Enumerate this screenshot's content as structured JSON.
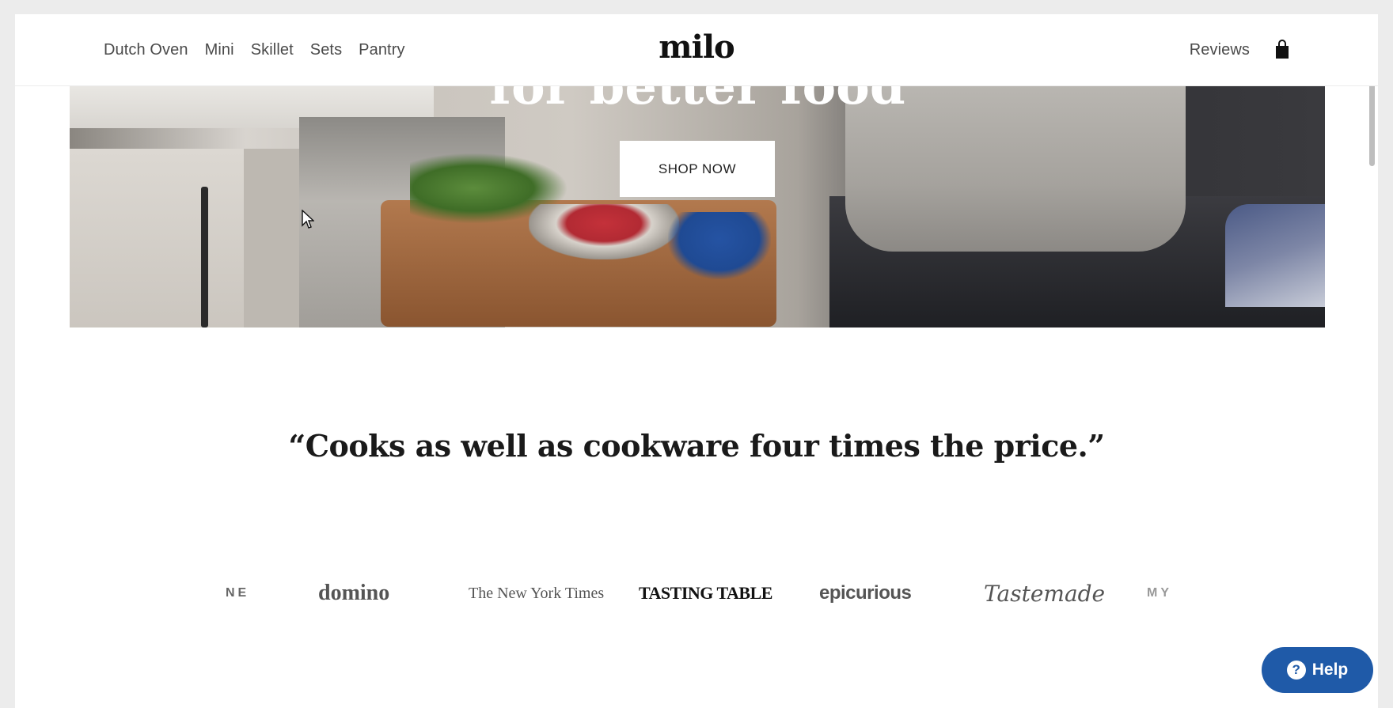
{
  "header": {
    "nav_left": [
      "Dutch Oven",
      "Mini",
      "Skillet",
      "Sets",
      "Pantry"
    ],
    "logo": "milo",
    "nav_right": {
      "reviews": "Reviews",
      "cart_icon": "shopping-bag-icon"
    }
  },
  "hero": {
    "headline": "for better food",
    "cta_label": "SHOP NOW"
  },
  "quote": {
    "text": "“Cooks as well as cookware four times the price.”"
  },
  "press_logos": [
    "NE",
    "domino",
    "The New York Times",
    "TASTING TABLE",
    "epicurious",
    "Tastemade",
    "MY"
  ],
  "help": {
    "label": "Help",
    "icon": "question-circle-icon"
  },
  "colors": {
    "help_button": "#1f5aa8",
    "page_bg": "#ffffff",
    "window_bg": "#ececec"
  }
}
